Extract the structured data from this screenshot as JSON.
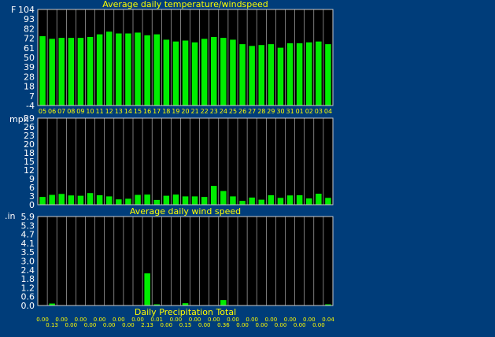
{
  "colors": {
    "background": "#003d7a",
    "plot_background": "#000000",
    "bar_fill": "#00ee00",
    "title_text": "#ffff00",
    "axis_text": "#ffffff",
    "grid": "#cccccc"
  },
  "chart_data": [
    {
      "id": "temperature",
      "type": "bar",
      "title": "Average daily temperature/windspeed",
      "ylabel": "F",
      "ylim": [
        -4,
        104
      ],
      "yticks": [
        "104",
        "93",
        "82",
        "72",
        "61",
        "50",
        "39",
        "28",
        "18",
        "7",
        "-4"
      ],
      "categories": [
        "05",
        "06",
        "07",
        "08",
        "09",
        "10",
        "11",
        "12",
        "13",
        "14",
        "15",
        "16",
        "17",
        "18",
        "19",
        "20",
        "21",
        "22",
        "23",
        "24",
        "25",
        "26",
        "27",
        "28",
        "29",
        "30",
        "31",
        "01",
        "02",
        "03",
        "04"
      ],
      "values": [
        74,
        71,
        72,
        72,
        72,
        73,
        76,
        79,
        77,
        77,
        78,
        75,
        76,
        70,
        68,
        69,
        67,
        71,
        73,
        72,
        70,
        65,
        63,
        64,
        65,
        61,
        66,
        66,
        67,
        68,
        65
      ],
      "grid": true
    },
    {
      "id": "windspeed",
      "type": "bar",
      "title": "Average daily wind speed",
      "ylabel": "mph",
      "ylim": [
        0,
        29
      ],
      "yticks": [
        "29",
        "26",
        "23",
        "20",
        "18",
        "15",
        "12",
        "9",
        "6",
        "3",
        "0"
      ],
      "values": [
        2.6,
        3.3,
        3.6,
        3.1,
        3.0,
        3.9,
        3.2,
        2.8,
        1.8,
        2.0,
        3.3,
        3.4,
        1.6,
        3.0,
        3.4,
        2.8,
        2.8,
        2.6,
        6.3,
        4.6,
        2.8,
        1.3,
        2.4,
        1.7,
        3.2,
        2.3,
        3.1,
        3.2,
        2.1,
        3.7,
        2.3
      ],
      "grid": true
    },
    {
      "id": "precipitation",
      "type": "bar",
      "title": "Daily Precipitation Total",
      "ylabel": ".in",
      "ylim": [
        0,
        5.9
      ],
      "yticks": [
        "5.9",
        "5.3",
        "4.7",
        "4.1",
        "3.5",
        "3.0",
        "2.4",
        "1.8",
        "1.2",
        "0.6",
        "0.0"
      ],
      "values": [
        0.0,
        0.13,
        0.0,
        0.0,
        0.0,
        0.0,
        0.0,
        0.0,
        0.0,
        0.0,
        0.0,
        2.13,
        0.01,
        0.0,
        0.0,
        0.15,
        0.0,
        0.0,
        0.0,
        0.36,
        0.0,
        0.0,
        0.0,
        0.0,
        0.0,
        0.0,
        0.0,
        0.0,
        0.0,
        0.0,
        0.04
      ],
      "value_labels": [
        "0.00",
        "0.13",
        "0.00",
        "0.00",
        "0.00",
        "0.00",
        "0.00",
        "0.00",
        "0.00",
        "0.00",
        "0.00",
        "2.13",
        "0.01",
        "0.00",
        "0.00",
        "0.15",
        "0.00",
        "0.00",
        "0.00",
        "0.36",
        "0.00",
        "0.00",
        "0.00",
        "0.00",
        "0.00",
        "0.00",
        "0.00",
        "0.00",
        "0.00",
        "0.00",
        "0.04"
      ],
      "grid": true
    }
  ]
}
